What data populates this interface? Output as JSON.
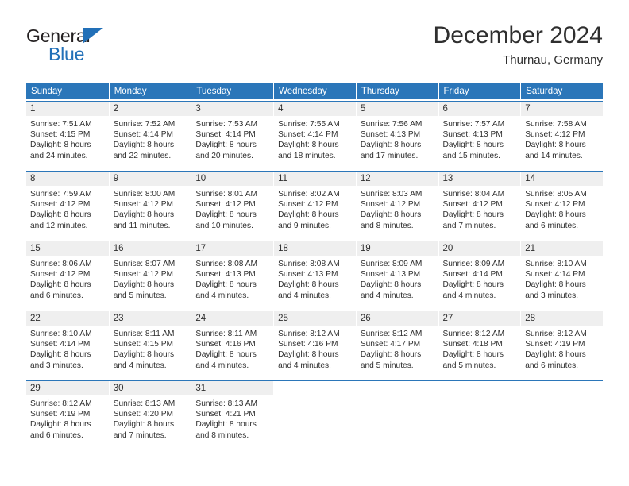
{
  "brand": {
    "name_part1": "General",
    "name_part2": "Blue",
    "triangle_color": "#2270b8"
  },
  "header": {
    "title": "December 2024",
    "subtitle": "Thurnau, Germany"
  },
  "theme": {
    "header_blue": "#2b76b9",
    "daynum_gray": "#efefef",
    "text": "#2f2f2f"
  },
  "weekdays": [
    "Sunday",
    "Monday",
    "Tuesday",
    "Wednesday",
    "Thursday",
    "Friday",
    "Saturday"
  ],
  "weeks": [
    [
      {
        "day": "1",
        "sunrise": "Sunrise: 7:51 AM",
        "sunset": "Sunset: 4:15 PM",
        "daylight1": "Daylight: 8 hours",
        "daylight2": "and 24 minutes."
      },
      {
        "day": "2",
        "sunrise": "Sunrise: 7:52 AM",
        "sunset": "Sunset: 4:14 PM",
        "daylight1": "Daylight: 8 hours",
        "daylight2": "and 22 minutes."
      },
      {
        "day": "3",
        "sunrise": "Sunrise: 7:53 AM",
        "sunset": "Sunset: 4:14 PM",
        "daylight1": "Daylight: 8 hours",
        "daylight2": "and 20 minutes."
      },
      {
        "day": "4",
        "sunrise": "Sunrise: 7:55 AM",
        "sunset": "Sunset: 4:14 PM",
        "daylight1": "Daylight: 8 hours",
        "daylight2": "and 18 minutes."
      },
      {
        "day": "5",
        "sunrise": "Sunrise: 7:56 AM",
        "sunset": "Sunset: 4:13 PM",
        "daylight1": "Daylight: 8 hours",
        "daylight2": "and 17 minutes."
      },
      {
        "day": "6",
        "sunrise": "Sunrise: 7:57 AM",
        "sunset": "Sunset: 4:13 PM",
        "daylight1": "Daylight: 8 hours",
        "daylight2": "and 15 minutes."
      },
      {
        "day": "7",
        "sunrise": "Sunrise: 7:58 AM",
        "sunset": "Sunset: 4:12 PM",
        "daylight1": "Daylight: 8 hours",
        "daylight2": "and 14 minutes."
      }
    ],
    [
      {
        "day": "8",
        "sunrise": "Sunrise: 7:59 AM",
        "sunset": "Sunset: 4:12 PM",
        "daylight1": "Daylight: 8 hours",
        "daylight2": "and 12 minutes."
      },
      {
        "day": "9",
        "sunrise": "Sunrise: 8:00 AM",
        "sunset": "Sunset: 4:12 PM",
        "daylight1": "Daylight: 8 hours",
        "daylight2": "and 11 minutes."
      },
      {
        "day": "10",
        "sunrise": "Sunrise: 8:01 AM",
        "sunset": "Sunset: 4:12 PM",
        "daylight1": "Daylight: 8 hours",
        "daylight2": "and 10 minutes."
      },
      {
        "day": "11",
        "sunrise": "Sunrise: 8:02 AM",
        "sunset": "Sunset: 4:12 PM",
        "daylight1": "Daylight: 8 hours",
        "daylight2": "and 9 minutes."
      },
      {
        "day": "12",
        "sunrise": "Sunrise: 8:03 AM",
        "sunset": "Sunset: 4:12 PM",
        "daylight1": "Daylight: 8 hours",
        "daylight2": "and 8 minutes."
      },
      {
        "day": "13",
        "sunrise": "Sunrise: 8:04 AM",
        "sunset": "Sunset: 4:12 PM",
        "daylight1": "Daylight: 8 hours",
        "daylight2": "and 7 minutes."
      },
      {
        "day": "14",
        "sunrise": "Sunrise: 8:05 AM",
        "sunset": "Sunset: 4:12 PM",
        "daylight1": "Daylight: 8 hours",
        "daylight2": "and 6 minutes."
      }
    ],
    [
      {
        "day": "15",
        "sunrise": "Sunrise: 8:06 AM",
        "sunset": "Sunset: 4:12 PM",
        "daylight1": "Daylight: 8 hours",
        "daylight2": "and 6 minutes."
      },
      {
        "day": "16",
        "sunrise": "Sunrise: 8:07 AM",
        "sunset": "Sunset: 4:12 PM",
        "daylight1": "Daylight: 8 hours",
        "daylight2": "and 5 minutes."
      },
      {
        "day": "17",
        "sunrise": "Sunrise: 8:08 AM",
        "sunset": "Sunset: 4:13 PM",
        "daylight1": "Daylight: 8 hours",
        "daylight2": "and 4 minutes."
      },
      {
        "day": "18",
        "sunrise": "Sunrise: 8:08 AM",
        "sunset": "Sunset: 4:13 PM",
        "daylight1": "Daylight: 8 hours",
        "daylight2": "and 4 minutes."
      },
      {
        "day": "19",
        "sunrise": "Sunrise: 8:09 AM",
        "sunset": "Sunset: 4:13 PM",
        "daylight1": "Daylight: 8 hours",
        "daylight2": "and 4 minutes."
      },
      {
        "day": "20",
        "sunrise": "Sunrise: 8:09 AM",
        "sunset": "Sunset: 4:14 PM",
        "daylight1": "Daylight: 8 hours",
        "daylight2": "and 4 minutes."
      },
      {
        "day": "21",
        "sunrise": "Sunrise: 8:10 AM",
        "sunset": "Sunset: 4:14 PM",
        "daylight1": "Daylight: 8 hours",
        "daylight2": "and 3 minutes."
      }
    ],
    [
      {
        "day": "22",
        "sunrise": "Sunrise: 8:10 AM",
        "sunset": "Sunset: 4:14 PM",
        "daylight1": "Daylight: 8 hours",
        "daylight2": "and 3 minutes."
      },
      {
        "day": "23",
        "sunrise": "Sunrise: 8:11 AM",
        "sunset": "Sunset: 4:15 PM",
        "daylight1": "Daylight: 8 hours",
        "daylight2": "and 4 minutes."
      },
      {
        "day": "24",
        "sunrise": "Sunrise: 8:11 AM",
        "sunset": "Sunset: 4:16 PM",
        "daylight1": "Daylight: 8 hours",
        "daylight2": "and 4 minutes."
      },
      {
        "day": "25",
        "sunrise": "Sunrise: 8:12 AM",
        "sunset": "Sunset: 4:16 PM",
        "daylight1": "Daylight: 8 hours",
        "daylight2": "and 4 minutes."
      },
      {
        "day": "26",
        "sunrise": "Sunrise: 8:12 AM",
        "sunset": "Sunset: 4:17 PM",
        "daylight1": "Daylight: 8 hours",
        "daylight2": "and 5 minutes."
      },
      {
        "day": "27",
        "sunrise": "Sunrise: 8:12 AM",
        "sunset": "Sunset: 4:18 PM",
        "daylight1": "Daylight: 8 hours",
        "daylight2": "and 5 minutes."
      },
      {
        "day": "28",
        "sunrise": "Sunrise: 8:12 AM",
        "sunset": "Sunset: 4:19 PM",
        "daylight1": "Daylight: 8 hours",
        "daylight2": "and 6 minutes."
      }
    ],
    [
      {
        "day": "29",
        "sunrise": "Sunrise: 8:12 AM",
        "sunset": "Sunset: 4:19 PM",
        "daylight1": "Daylight: 8 hours",
        "daylight2": "and 6 minutes."
      },
      {
        "day": "30",
        "sunrise": "Sunrise: 8:13 AM",
        "sunset": "Sunset: 4:20 PM",
        "daylight1": "Daylight: 8 hours",
        "daylight2": "and 7 minutes."
      },
      {
        "day": "31",
        "sunrise": "Sunrise: 8:13 AM",
        "sunset": "Sunset: 4:21 PM",
        "daylight1": "Daylight: 8 hours",
        "daylight2": "and 8 minutes."
      },
      {
        "day": "",
        "sunrise": "",
        "sunset": "",
        "daylight1": "",
        "daylight2": ""
      },
      {
        "day": "",
        "sunrise": "",
        "sunset": "",
        "daylight1": "",
        "daylight2": ""
      },
      {
        "day": "",
        "sunrise": "",
        "sunset": "",
        "daylight1": "",
        "daylight2": ""
      },
      {
        "day": "",
        "sunrise": "",
        "sunset": "",
        "daylight1": "",
        "daylight2": ""
      }
    ]
  ]
}
